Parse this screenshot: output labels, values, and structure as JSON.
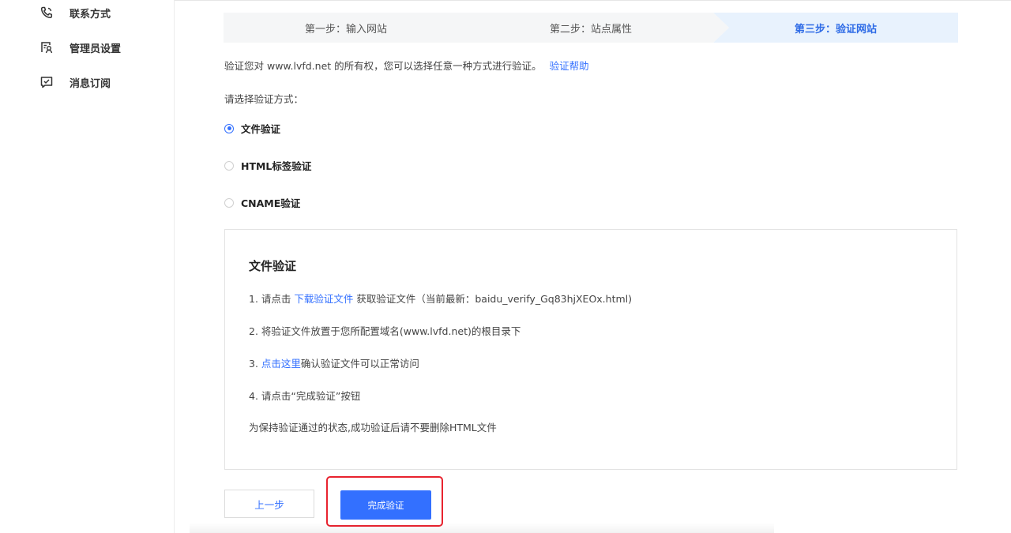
{
  "sidebar": {
    "items": [
      {
        "label": "联系方式",
        "icon": "phone-icon"
      },
      {
        "label": "管理员设置",
        "icon": "admin-settings-icon"
      },
      {
        "label": "消息订阅",
        "icon": "message-subscription-icon"
      }
    ]
  },
  "steps": [
    {
      "label": "第一步：输入网站",
      "state": "done"
    },
    {
      "label": "第二步：站点属性",
      "state": "done"
    },
    {
      "label": "第三步：验证网站",
      "state": "active"
    }
  ],
  "description": {
    "text": "验证您对 www.lvfd.net 的所有权，您可以选择任意一种方式进行验证。",
    "help_link": "验证帮助"
  },
  "choose_label": "请选择验证方式：",
  "methods": [
    {
      "label": "文件验证",
      "selected": true
    },
    {
      "label": "HTML标签验证",
      "selected": false
    },
    {
      "label": "CNAME验证",
      "selected": false
    }
  ],
  "panel": {
    "title": "文件验证",
    "step1_prefix": "1. 请点击 ",
    "step1_link": "下载验证文件",
    "step1_suffix": " 获取验证文件（当前最新：baidu_verify_Gq83hjXEOx.html)",
    "step2": "2. 将验证文件放置于您所配置域名(www.lvfd.net)的根目录下",
    "step3_prefix": "3. ",
    "step3_link": "点击这里",
    "step3_suffix": "确认验证文件可以正常访问",
    "step4": "4. 请点击“完成验证”按钮",
    "note": "为保持验证通过的状态,成功验证后请不要删除HTML文件"
  },
  "buttons": {
    "prev": "上一步",
    "done": "完成验证"
  },
  "colors": {
    "accent": "#3370ff",
    "active_step_bg": "#e8f2fd",
    "step_bg": "#f5f6f7",
    "highlight": "#e8232f"
  }
}
